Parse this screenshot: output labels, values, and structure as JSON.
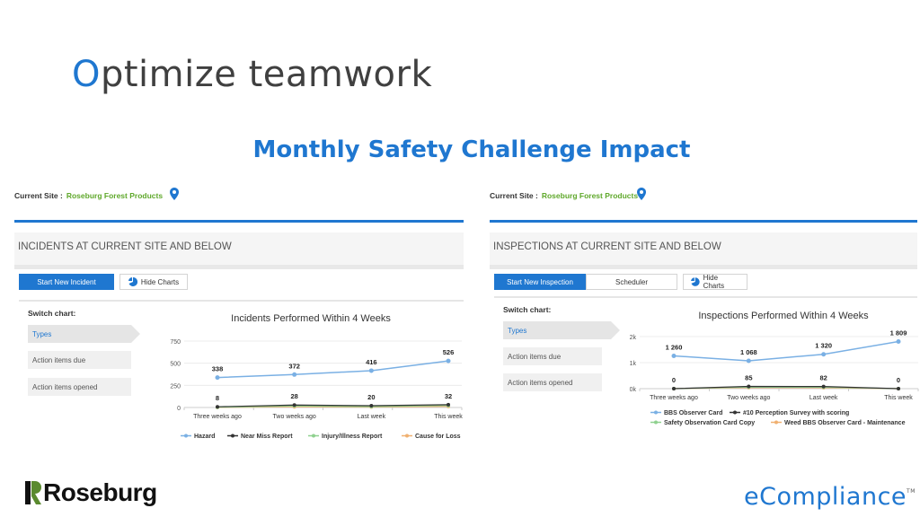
{
  "slide": {
    "title_first": "O",
    "title_rest": "ptimize teamwork",
    "subtitle": "Monthly Safety Challenge Impact"
  },
  "left_panel": {
    "site_label": "Current Site :",
    "site_name": "Roseburg Forest Products",
    "section_title": "INCIDENTS AT CURRENT SITE AND BELOW",
    "buttons": {
      "start_new": "Start New Incident",
      "hide_charts": "Hide Charts"
    },
    "switch_label": "Switch chart:",
    "switch_items": [
      "Types",
      "Action items due",
      "Action items opened"
    ]
  },
  "right_panel": {
    "site_label": "Current Site :",
    "site_name": "Roseburg Forest Products",
    "section_title": "INSPECTIONS AT CURRENT SITE AND BELOW",
    "buttons": {
      "start_new": "Start New Inspection",
      "scheduler": "Scheduler",
      "hide_charts": "Hide Charts"
    },
    "switch_label": "Switch chart:",
    "switch_items": [
      "Types",
      "Action items due",
      "Action items opened"
    ]
  },
  "logos": {
    "roseburg": "Roseburg",
    "ecompliance": "eCompliance",
    "tm": "TM"
  },
  "colors": {
    "accent": "#1f77d0",
    "site_green": "#5fa82b",
    "series_blue": "#7ab0e4",
    "series_dark": "#333333",
    "series_green": "#8fd18f",
    "series_orange": "#f0b070"
  },
  "chart_data": [
    {
      "type": "line",
      "title": "Incidents Performed Within 4 Weeks",
      "categories": [
        "Three weeks ago",
        "Two weeks ago",
        "Last week",
        "This week"
      ],
      "ylim": [
        0,
        750
      ],
      "yticks": [
        "0",
        "250",
        "500",
        "750"
      ],
      "series": [
        {
          "name": "Hazard",
          "values": [
            338,
            372,
            416,
            526
          ],
          "labels": [
            "338",
            "372",
            "416",
            "526"
          ],
          "color": "#7ab0e4"
        },
        {
          "name": "Near Miss Report",
          "values": [
            8,
            28,
            20,
            32
          ],
          "labels": [
            "8",
            "28",
            "20",
            "32"
          ],
          "color": "#333333"
        },
        {
          "name": "Injury/Illness Report",
          "values": [
            3,
            18,
            10,
            22
          ],
          "color": "#8fd18f"
        },
        {
          "name": "Cause for Loss",
          "values": [
            1,
            8,
            5,
            12
          ],
          "color": "#f0b070"
        }
      ],
      "legend": "bottom"
    },
    {
      "type": "line",
      "title": "Inspections Performed Within 4 Weeks",
      "categories": [
        "Three weeks ago",
        "Two weeks ago",
        "Last week",
        "This week"
      ],
      "ylim": [
        0,
        2000
      ],
      "yticks": [
        "0k",
        "1k",
        "2k"
      ],
      "series": [
        {
          "name": "BBS Observer Card",
          "values": [
            1260,
            1068,
            1320,
            1809
          ],
          "labels": [
            "1 260",
            "1 068",
            "1 320",
            "1 809"
          ],
          "color": "#7ab0e4"
        },
        {
          "name": "#10 Perception Survey with scoring",
          "values": [
            0,
            85,
            82,
            0
          ],
          "labels": [
            "0",
            "85",
            "82",
            "0"
          ],
          "color": "#333333"
        },
        {
          "name": "Safety Observation Card Copy",
          "values": [
            0,
            60,
            55,
            0
          ],
          "color": "#8fd18f"
        },
        {
          "name": "Weed BBS Observer Card - Maintenance",
          "values": [
            0,
            40,
            35,
            0
          ],
          "color": "#f0b070"
        }
      ],
      "legend": "bottom"
    }
  ]
}
